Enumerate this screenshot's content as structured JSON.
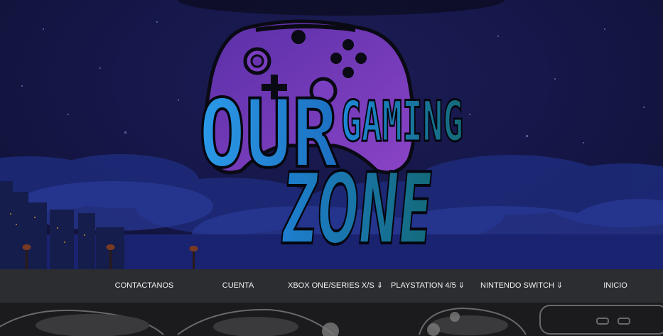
{
  "logo": {
    "line1": "OUR",
    "line2": "GAMING",
    "line3": "ZONE"
  },
  "nav": {
    "items": [
      {
        "label": "CONTACTANOS"
      },
      {
        "label": "CUENTA"
      },
      {
        "label": "XBOX ONE/SERIES X/S ⇓"
      },
      {
        "label": "PLAYSTATION 4/5 ⇓"
      },
      {
        "label": "NINTENDO SWITCH ⇓"
      },
      {
        "label": "INICIO"
      }
    ]
  },
  "colors": {
    "navbar_bg": "#2c2d31",
    "nav_text": "#f2f2f2",
    "hero_bg": "#16174a",
    "controller_purple": "#7a3fc0",
    "logo_blue": "#1f8fe0",
    "logo_teal": "#16707e"
  }
}
